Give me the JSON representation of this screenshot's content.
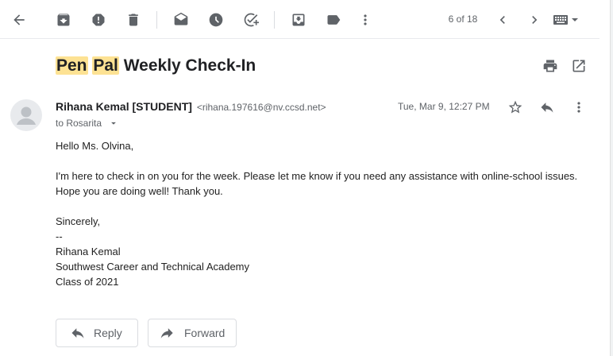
{
  "toolbar": {
    "buttons": [
      {
        "name": "back",
        "icon": "arrow-left-icon"
      },
      {
        "name": "archive",
        "icon": "archive-icon"
      },
      {
        "name": "report-spam",
        "icon": "report-spam-icon"
      },
      {
        "name": "delete",
        "icon": "trash-icon"
      },
      {
        "name": "mark-unread",
        "icon": "mark-unread-icon"
      },
      {
        "name": "snooze",
        "icon": "clock-icon"
      },
      {
        "name": "add-task",
        "icon": "add-task-icon"
      },
      {
        "name": "move-to",
        "icon": "move-to-inbox-icon"
      },
      {
        "name": "labels",
        "icon": "label-icon"
      },
      {
        "name": "more",
        "icon": "more-vert-icon"
      }
    ],
    "pager": "6 of 18",
    "pager_prev_icon": "chevron-left-icon",
    "pager_next_icon": "chevron-right-icon",
    "input_tools_icon": "keyboard-icon"
  },
  "email": {
    "subject_highlight_1": "Pen",
    "subject_space": " ",
    "subject_highlight_2": "Pal",
    "subject_rest": " Weekly Check-In",
    "highlight_color": "#fde293",
    "sender_name": "Rihana Kemal [STUDENT]",
    "sender_email": "<rihana.197616@nv.ccsd.net>",
    "to_label": "to Rosarita",
    "date": "Tue, Mar 9, 12:27 PM",
    "body_lines": [
      "Hello Ms. Olvina,",
      "",
      "I'm here to check in on you for the week. Please let me know if you need any assistance with online-school issues.",
      "Hope you are doing well! Thank you.",
      "",
      "Sincerely,",
      "--",
      "Rihana Kemal",
      "Southwest Career and Technical Academy",
      "Class of 2021"
    ]
  },
  "actions": {
    "reply_label": "Reply",
    "forward_label": "Forward"
  }
}
